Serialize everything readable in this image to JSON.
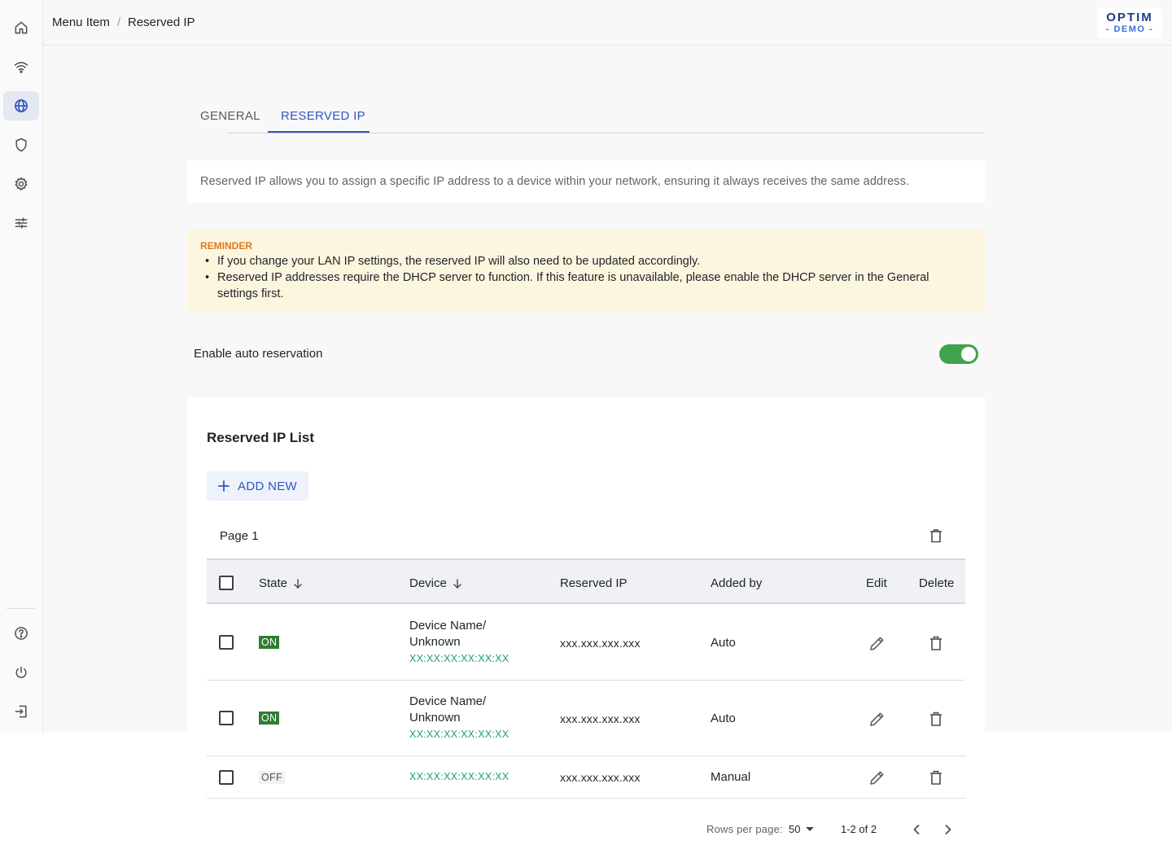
{
  "breadcrumb": {
    "parent": "Menu Item",
    "separator": "/",
    "current": "Reserved IP"
  },
  "logo": {
    "line1": "OPTIM",
    "line2": "- DEMO -"
  },
  "sidebar": {
    "items": [
      {
        "icon": "home-icon"
      },
      {
        "icon": "wifi-icon"
      },
      {
        "icon": "globe-icon",
        "active": true
      },
      {
        "icon": "shield-icon"
      },
      {
        "icon": "gear-icon"
      },
      {
        "icon": "sliders-icon"
      }
    ],
    "bottom": [
      {
        "icon": "help-icon"
      },
      {
        "icon": "power-icon"
      },
      {
        "icon": "logout-icon"
      }
    ]
  },
  "tabs": [
    {
      "label": "GENERAL"
    },
    {
      "label": "RESERVED IP",
      "active": true
    }
  ],
  "description": "Reserved IP allows you to assign a specific IP address to a device within your network, ensuring it always receives the same address.",
  "reminder": {
    "title": "REMINDER",
    "items": [
      "If you change your LAN IP settings, the reserved IP will also need to be updated accordingly.",
      "Reserved IP addresses require the DHCP server to function. If this feature is unavailable, please enable the DHCP server in the General settings first."
    ]
  },
  "auto_reservation": {
    "label": "Enable auto reservation",
    "enabled": true
  },
  "list": {
    "title": "Reserved IP List",
    "add_label": "ADD NEW",
    "page_label": "Page 1",
    "columns": {
      "state": "State",
      "device": "Device",
      "reserved_ip": "Reserved IP",
      "added_by": "Added by",
      "edit": "Edit",
      "delete": "Delete"
    },
    "rows": [
      {
        "state": "ON",
        "device_name": "Device Name/ Unknown",
        "mac": "XX:XX:XX:XX:XX:XX",
        "ip": "xxx.xxx.xxx.xxx",
        "added_by": "Auto"
      },
      {
        "state": "ON",
        "device_name": "Device Name/ Unknown",
        "mac": "XX:XX:XX:XX:XX:XX",
        "ip": "xxx.xxx.xxx.xxx",
        "added_by": "Auto"
      },
      {
        "state": "OFF",
        "device_name": "",
        "mac": "XX:XX:XX:XX:XX:XX",
        "ip": "xxx.xxx.xxx.xxx",
        "added_by": "Manual"
      }
    ]
  },
  "pagination": {
    "rows_label": "Rows per page:",
    "rows_value": "50",
    "range": "1-2 of 2"
  },
  "colors": {
    "accent": "#3254c7",
    "on_badge": "#2e7d32",
    "toggle_on": "#3fa34d",
    "mac_text": "#1a9e84",
    "reminder_bg": "#fdf6df",
    "reminder_title": "#e07a1c"
  }
}
